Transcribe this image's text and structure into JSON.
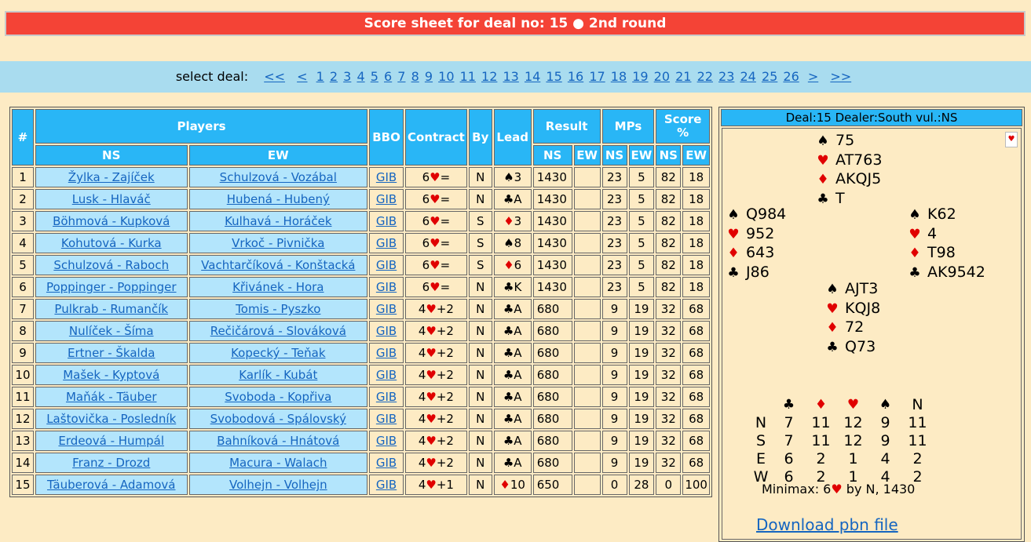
{
  "title": "Score sheet for deal no: 15 ● 2nd round",
  "nav": {
    "label": "select deal:",
    "first": "<<",
    "prev": "<",
    "deals": [
      "1",
      "2",
      "3",
      "4",
      "5",
      "6",
      "7",
      "8",
      "9",
      "10",
      "11",
      "12",
      "13",
      "14",
      "15",
      "16",
      "17",
      "18",
      "19",
      "20",
      "21",
      "22",
      "23",
      "24",
      "25",
      "26"
    ],
    "next": ">",
    "last": ">>"
  },
  "table": {
    "headers": {
      "num": "#",
      "players": "Players",
      "ns": "NS",
      "ew": "EW",
      "bbo": "BBO",
      "contract": "Contract",
      "by": "By",
      "lead": "Lead",
      "result": "Result",
      "mps": "MPs",
      "score": "Score %",
      "res_ns": "NS",
      "res_ew": "EW",
      "mp_ns": "NS",
      "mp_ew": "EW",
      "sc_ns": "NS",
      "sc_ew": "EW"
    },
    "rows": [
      {
        "n": "1",
        "ns": "Žylka - Zajíček",
        "ew": "Schulzová - Vozábal",
        "bbo": "GIB",
        "level": "6",
        "csuit": "♥",
        "cres": "=",
        "by": "N",
        "lsuit": "♠",
        "lcard": "3",
        "res": "1430",
        "resew": "",
        "mpns": "23",
        "mpew": "5",
        "scns": "82",
        "scew": "18"
      },
      {
        "n": "2",
        "ns": "Lusk - Hlaváč",
        "ew": "Hubená - Hubený",
        "bbo": "GIB",
        "level": "6",
        "csuit": "♥",
        "cres": "=",
        "by": "N",
        "lsuit": "♣",
        "lcard": "A",
        "res": "1430",
        "resew": "",
        "mpns": "23",
        "mpew": "5",
        "scns": "82",
        "scew": "18"
      },
      {
        "n": "3",
        "ns": "Böhmová - Kupková",
        "ew": "Kulhavá - Horáček",
        "bbo": "GIB",
        "level": "6",
        "csuit": "♥",
        "cres": "=",
        "by": "S",
        "lsuit": "♦",
        "lcard": "3",
        "res": "1430",
        "resew": "",
        "mpns": "23",
        "mpew": "5",
        "scns": "82",
        "scew": "18"
      },
      {
        "n": "4",
        "ns": "Kohutová - Kurka",
        "ew": "Vrkoč - Pivnička",
        "bbo": "GIB",
        "level": "6",
        "csuit": "♥",
        "cres": "=",
        "by": "S",
        "lsuit": "♠",
        "lcard": "8",
        "res": "1430",
        "resew": "",
        "mpns": "23",
        "mpew": "5",
        "scns": "82",
        "scew": "18"
      },
      {
        "n": "5",
        "ns": "Schulzová - Raboch",
        "ew": "Vachtarčíková - Konštacká",
        "bbo": "GIB",
        "level": "6",
        "csuit": "♥",
        "cres": "=",
        "by": "S",
        "lsuit": "♦",
        "lcard": "6",
        "res": "1430",
        "resew": "",
        "mpns": "23",
        "mpew": "5",
        "scns": "82",
        "scew": "18"
      },
      {
        "n": "6",
        "ns": "Poppinger - Poppinger",
        "ew": "Křivánek - Hora",
        "bbo": "GIB",
        "level": "6",
        "csuit": "♥",
        "cres": "=",
        "by": "N",
        "lsuit": "♣",
        "lcard": "K",
        "res": "1430",
        "resew": "",
        "mpns": "23",
        "mpew": "5",
        "scns": "82",
        "scew": "18"
      },
      {
        "n": "7",
        "ns": "Pulkrab - Rumančík",
        "ew": "Tomis - Pyszko",
        "bbo": "GIB",
        "level": "4",
        "csuit": "♥",
        "cres": "+2",
        "by": "N",
        "lsuit": "♣",
        "lcard": "A",
        "res": "680",
        "resew": "",
        "mpns": "9",
        "mpew": "19",
        "scns": "32",
        "scew": "68"
      },
      {
        "n": "8",
        "ns": "Nulíček - Šíma",
        "ew": "Rečičárová - Slováková",
        "bbo": "GIB",
        "level": "4",
        "csuit": "♥",
        "cres": "+2",
        "by": "N",
        "lsuit": "♣",
        "lcard": "A",
        "res": "680",
        "resew": "",
        "mpns": "9",
        "mpew": "19",
        "scns": "32",
        "scew": "68"
      },
      {
        "n": "9",
        "ns": "Ertner - Škalda",
        "ew": "Kopecký - Teňak",
        "bbo": "GIB",
        "level": "4",
        "csuit": "♥",
        "cres": "+2",
        "by": "N",
        "lsuit": "♣",
        "lcard": "A",
        "res": "680",
        "resew": "",
        "mpns": "9",
        "mpew": "19",
        "scns": "32",
        "scew": "68"
      },
      {
        "n": "10",
        "ns": "Mašek - Kyptová",
        "ew": "Karlík - Kubát",
        "bbo": "GIB",
        "level": "4",
        "csuit": "♥",
        "cres": "+2",
        "by": "N",
        "lsuit": "♣",
        "lcard": "A",
        "res": "680",
        "resew": "",
        "mpns": "9",
        "mpew": "19",
        "scns": "32",
        "scew": "68"
      },
      {
        "n": "11",
        "ns": "Maňák - Täuber",
        "ew": "Svoboda - Kopřiva",
        "bbo": "GIB",
        "level": "4",
        "csuit": "♥",
        "cres": "+2",
        "by": "N",
        "lsuit": "♣",
        "lcard": "A",
        "res": "680",
        "resew": "",
        "mpns": "9",
        "mpew": "19",
        "scns": "32",
        "scew": "68"
      },
      {
        "n": "12",
        "ns": "Laštovička - Posledník",
        "ew": "Svobodová - Spálovský",
        "bbo": "GIB",
        "level": "4",
        "csuit": "♥",
        "cres": "+2",
        "by": "N",
        "lsuit": "♣",
        "lcard": "A",
        "res": "680",
        "resew": "",
        "mpns": "9",
        "mpew": "19",
        "scns": "32",
        "scew": "68"
      },
      {
        "n": "13",
        "ns": "Erdeová - Humpál",
        "ew": "Bahníková - Hnátová",
        "bbo": "GIB",
        "level": "4",
        "csuit": "♥",
        "cres": "+2",
        "by": "N",
        "lsuit": "♣",
        "lcard": "A",
        "res": "680",
        "resew": "",
        "mpns": "9",
        "mpew": "19",
        "scns": "32",
        "scew": "68"
      },
      {
        "n": "14",
        "ns": "Franz - Drozd",
        "ew": "Macura - Walach",
        "bbo": "GIB",
        "level": "4",
        "csuit": "♥",
        "cres": "+2",
        "by": "N",
        "lsuit": "♣",
        "lcard": "A",
        "res": "680",
        "resew": "",
        "mpns": "9",
        "mpew": "19",
        "scns": "32",
        "scew": "68"
      },
      {
        "n": "15",
        "ns": "Täuberová - Adamová",
        "ew": "Volhejn - Volhejn",
        "bbo": "GIB",
        "level": "4",
        "csuit": "♥",
        "cres": "+1",
        "by": "N",
        "lsuit": "♦",
        "lcard": "10",
        "res": "650",
        "resew": "",
        "mpns": "0",
        "mpew": "28",
        "scns": "0",
        "scew": "100"
      }
    ]
  },
  "deal": {
    "header": "Deal:15 Dealer:South  vul.:NS",
    "suits": {
      "spade": "♠",
      "heart": "♥",
      "diamond": "♦",
      "club": "♣"
    },
    "north": {
      "spades": "75",
      "hearts": "AT763",
      "diamonds": "AKQJ5",
      "clubs": "T"
    },
    "west": {
      "spades": "Q984",
      "hearts": "952",
      "diamonds": "643",
      "clubs": "J86"
    },
    "east": {
      "spades": "K62",
      "hearts": "4",
      "diamonds": "T98",
      "clubs": "AK9542"
    },
    "south": {
      "spades": "AJT3",
      "hearts": "KQJ8",
      "diamonds": "72",
      "clubs": "Q73"
    },
    "dd_table": {
      "headers": [
        "♣",
        "♦",
        "♥",
        "♠",
        "N"
      ],
      "rows": [
        {
          "seat": "N",
          "values": [
            "7",
            "11",
            "12",
            "9",
            "11"
          ]
        },
        {
          "seat": "S",
          "values": [
            "7",
            "11",
            "12",
            "9",
            "11"
          ]
        },
        {
          "seat": "E",
          "values": [
            "6",
            "2",
            "1",
            "4",
            "2"
          ]
        },
        {
          "seat": "W",
          "values": [
            "6",
            "2",
            "1",
            "4",
            "2"
          ]
        }
      ]
    },
    "minimax": {
      "prefix": "Minimax: 6",
      "suit": "♥",
      "suffix": " by N, 1430"
    },
    "download": "Download pbn file"
  },
  "colors": {
    "title_bg": "#f44336",
    "nav_bg": "#a9dcef",
    "header_bg": "#29b6f6",
    "row_bg": "#b3e5fc",
    "page_bg": "#fdebc4",
    "link": "#1565c0",
    "red_suit": "#e00000"
  }
}
